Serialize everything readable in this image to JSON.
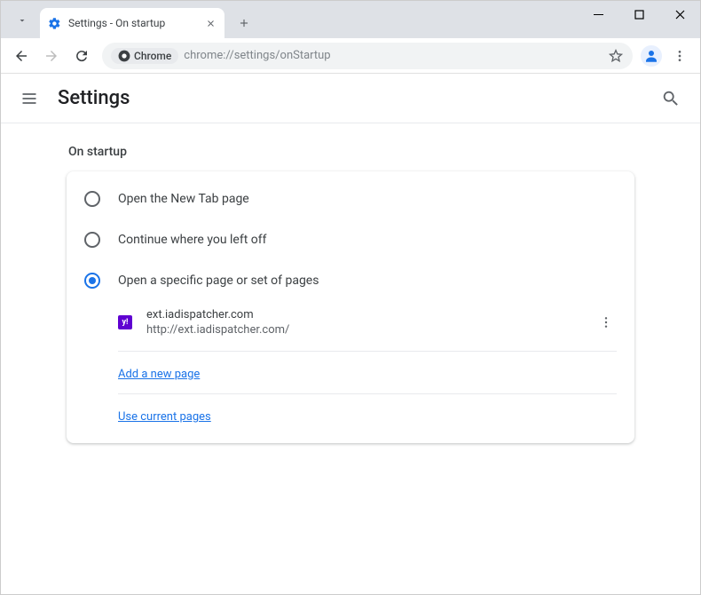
{
  "titlebar": {
    "tab_title": "Settings - On startup"
  },
  "toolbar": {
    "chrome_chip": "Chrome",
    "url": "chrome://settings/onStartup"
  },
  "header": {
    "title": "Settings"
  },
  "section": {
    "title": "On startup"
  },
  "radios": {
    "new_tab": "Open the New Tab page",
    "continue": "Continue where you left off",
    "specific": "Open a specific page or set of pages"
  },
  "page_entry": {
    "favicon_text": "y!",
    "title": "ext.iadispatcher.com",
    "url": "http://ext.iadispatcher.com/"
  },
  "links": {
    "add_page": "Add a new page",
    "use_current": "Use current pages"
  }
}
